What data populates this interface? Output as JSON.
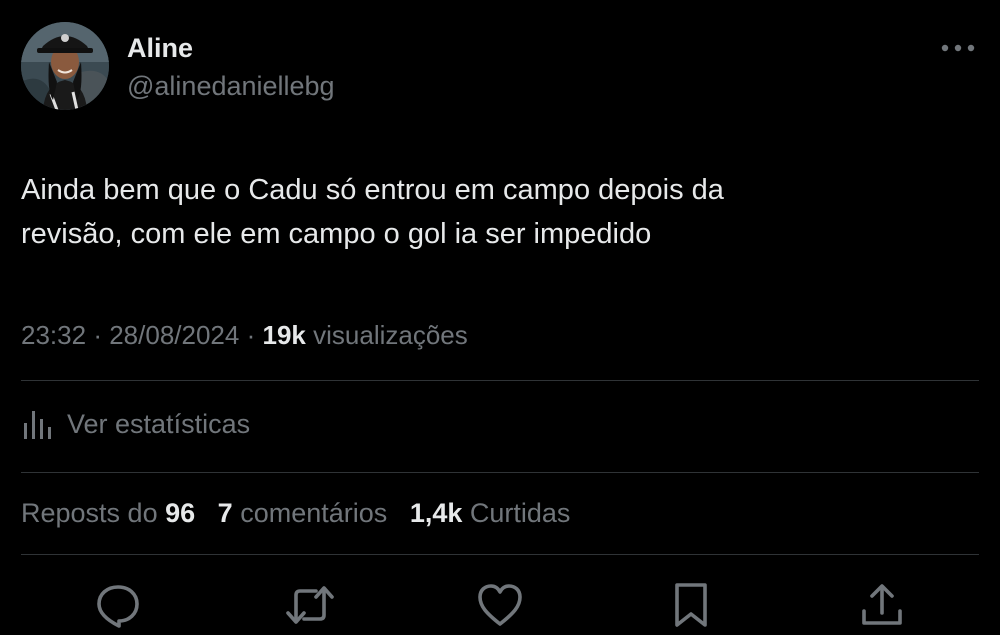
{
  "author": {
    "name": "Aline",
    "handle": "@alinedaniellebg",
    "avatar_icon": "profile-photo"
  },
  "tweet": {
    "text": "Ainda bem que o Cadu só entrou em campo depois da\nrevisão, com ele em campo o gol ia ser impedido"
  },
  "meta": {
    "time": "23:32",
    "separator": "·",
    "date": "28/08/2024",
    "views_count": "19k",
    "views_label": "visualizações"
  },
  "stats_link": {
    "label": "Ver estatísticas",
    "icon": "analytics-icon"
  },
  "counts": {
    "reposts_label": "Reposts do",
    "reposts": "96",
    "comments": "7",
    "comments_label": "comentários",
    "likes": "1,4k",
    "likes_label": "Curtidas"
  },
  "actions": [
    {
      "name": "reply",
      "icon": "reply-icon"
    },
    {
      "name": "repost",
      "icon": "repost-icon"
    },
    {
      "name": "like",
      "icon": "heart-icon"
    },
    {
      "name": "bookmark",
      "icon": "bookmark-icon"
    },
    {
      "name": "share",
      "icon": "share-icon"
    }
  ],
  "colors": {
    "background": "#000000",
    "primary_text": "#e7e9ea",
    "secondary_text": "#71767b",
    "divider": "#2f3336"
  }
}
